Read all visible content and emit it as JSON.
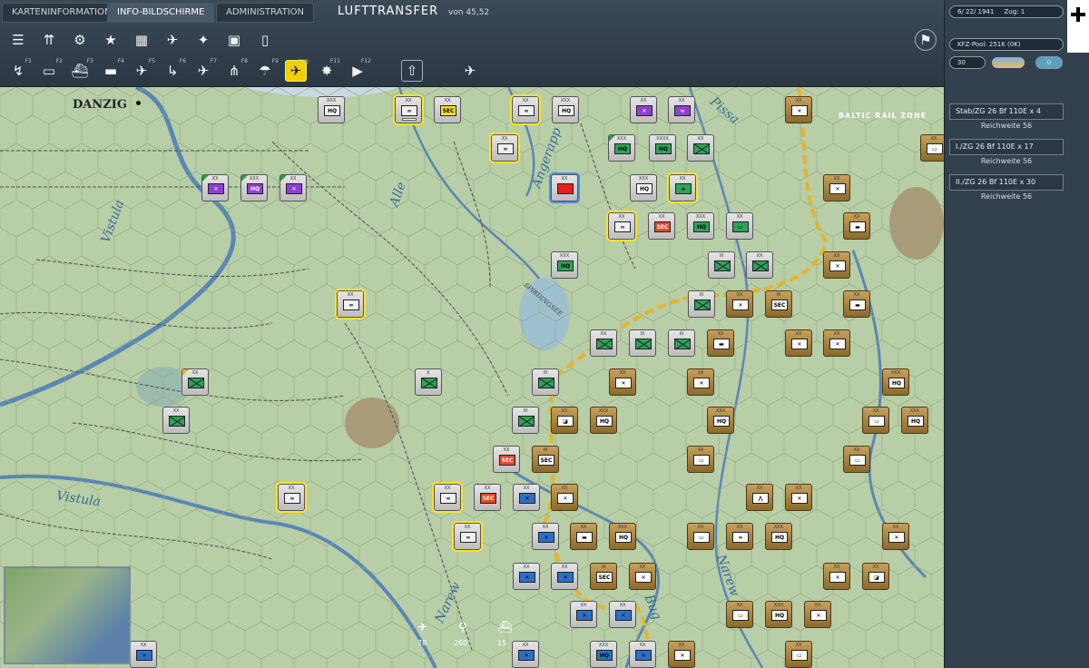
{
  "tabs": [
    {
      "label": "KARTENINFORMATION"
    },
    {
      "label": "INFO-BILDSCHIRME"
    },
    {
      "label": "ADMINISTRATION"
    }
  ],
  "header": {
    "title": "LUFTTRANSFER",
    "subtitle": "von 45,52"
  },
  "toolbar1": [
    {
      "icon": "list-icon"
    },
    {
      "icon": "units-icon"
    },
    {
      "icon": "gear-icon"
    },
    {
      "icon": "star-icon"
    },
    {
      "icon": "map-icon"
    },
    {
      "icon": "air-icon"
    },
    {
      "icon": "satellite-icon"
    },
    {
      "icon": "fuel-icon"
    },
    {
      "icon": "phone-icon"
    }
  ],
  "toolbar2": [
    {
      "icon": "path-icon",
      "key": "F1"
    },
    {
      "icon": "train-icon",
      "key": "F2"
    },
    {
      "icon": "ship-icon",
      "key": "F3"
    },
    {
      "icon": "ship2-icon",
      "key": "F4"
    },
    {
      "icon": "plane-icon",
      "key": "F5"
    },
    {
      "icon": "arrow-icon",
      "key": "F6"
    },
    {
      "icon": "bomber-icon",
      "key": "F7"
    },
    {
      "icon": "aa-icon",
      "key": "F8"
    },
    {
      "icon": "para-icon",
      "key": "F9"
    },
    {
      "icon": "airtransfer-icon",
      "key": "F10"
    },
    {
      "icon": "explosion-icon",
      "key": "F11"
    },
    {
      "icon": "play-icon",
      "key": "F12"
    },
    {
      "icon": "upload-icon"
    },
    {
      "icon": "fighters-icon"
    }
  ],
  "status": {
    "date": "6/ 22/ 1941",
    "turn": "Zug: 1",
    "pool": "KFZ-Pool: 251K (0K)",
    "value": "30",
    "counter": "0"
  },
  "air_units": [
    {
      "name": "Stab/ZG 26 Bf 110E x 4",
      "range": "Reichweite  56"
    },
    {
      "name": "I./ZG 26 Bf 110E x 17",
      "range": "Reichweite  56"
    },
    {
      "name": "II./ZG 26 Bf 110E x 30",
      "range": "Reichweite  56"
    }
  ],
  "map": {
    "city": "DANZIG",
    "rivers": [
      "Vistula",
      "Alle",
      "Angerapp",
      "Pissa",
      "Vistula",
      "Narew",
      "Narew",
      "Bug"
    ],
    "lake": "SPIRDINGSEE",
    "zone": "BALTIC RAIL ZONE"
  },
  "bottom_counts": [
    "78",
    "260",
    "15"
  ],
  "labels": {
    "hq": "HQ",
    "sec": "SEC"
  }
}
